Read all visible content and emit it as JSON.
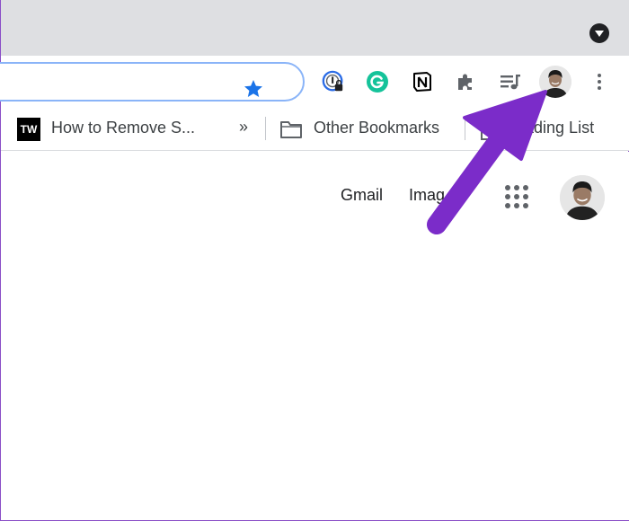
{
  "toolbar": {
    "bookmark_star": "star-icon",
    "extensions": [
      "onepassword-icon",
      "grammarly-icon",
      "notion-icon",
      "puzzle-icon",
      "media-control-icon"
    ]
  },
  "bookmarks_bar": {
    "item1": {
      "icon_text": "TW",
      "label": "How to Remove S..."
    },
    "overflow": "»",
    "other_bookmarks": "Other Bookmarks",
    "reading_list": "Reading List"
  },
  "page": {
    "gmail": "Gmail",
    "images": "Imag"
  },
  "colors": {
    "accent_arrow": "#7b2cc9",
    "omnibox_focus": "#8ab4f8",
    "star": "#1a73e8",
    "grammarly": "#15c39a"
  }
}
